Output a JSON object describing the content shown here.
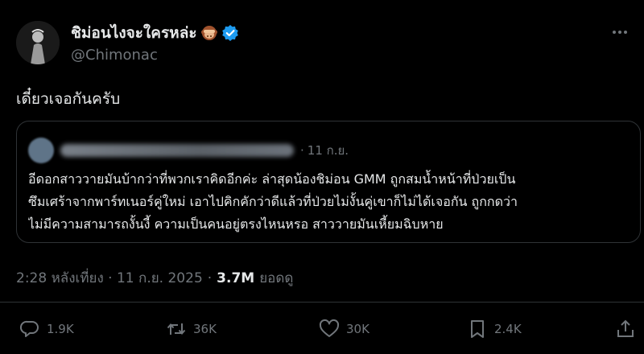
{
  "author": {
    "display_name": "ชิม่อนไงจะใครหล่ะ",
    "handle": "@Chimonac",
    "name_emoji_icon": "see-no-evil-monkey-icon",
    "verified_icon": "verified-badge-icon",
    "verified_color": "#1d9bf0"
  },
  "tweet": {
    "text": "เดี๋ยวเจอกันครับ"
  },
  "quoted": {
    "separator": "·",
    "date": "11 ก.ย.",
    "lines": [
      "อีดอกสาววายมันบ้ากว่าที่พวกเราคิดอีกค่ะ ล่าสุดน้องชิม่อน GMM ถูกสมน้ำหน้าที่ป่วยเป็น",
      "ซึมเศร้าจากพาร์ทเนอร์คู่ใหม่ เอาไปคิกคักว่าดีแล้วที่ป่วยไม่งั้นคู่เขาก็ไม่ได้เจอกัน ถูกกดว่า",
      "ไม่มีความสามารถงั้นงี้ ความเป็นคนอยู่ตรงไหนหรอ สาววายมันเหี้ยมฉิบหาย"
    ]
  },
  "meta": {
    "time_date": "2:28 หลังเที่ยง · 11 ก.ย. 2025",
    "separator": "·",
    "views_count": "3.7M",
    "views_label": "ยอดดู"
  },
  "actions": {
    "reply_count": "1.9K",
    "retweet_count": "36K",
    "like_count": "30K",
    "bookmark_count": "2.4K"
  },
  "colors": {
    "background": "#000000",
    "text": "#e7e9ea",
    "muted": "#71767b",
    "border": "#2f3336"
  }
}
